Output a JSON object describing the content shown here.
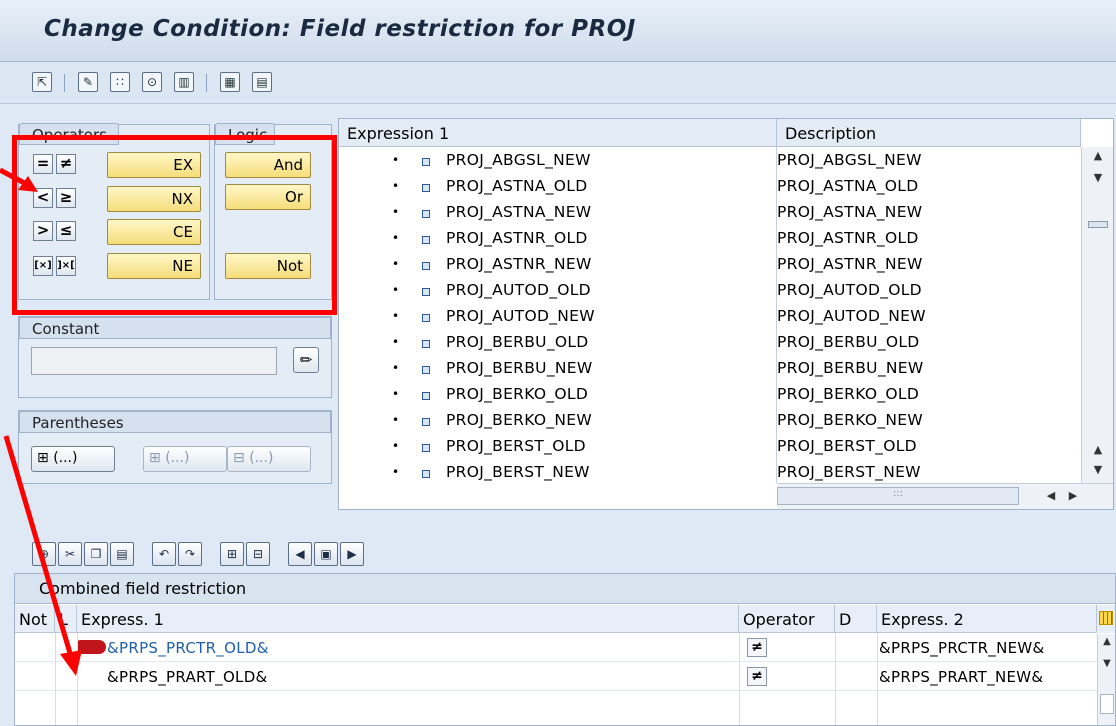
{
  "header": {
    "title": "Change Condition: Field restriction for PROJ"
  },
  "toolbar": {
    "icons": [
      "back-icon",
      "edit-icon",
      "formula-icon",
      "check-icon",
      "table-icon",
      "pattern-icon",
      "grid-icon"
    ]
  },
  "operators": {
    "label": "Operators",
    "symbols": [
      "=",
      "≠",
      "<",
      "≥",
      ">",
      "≤",
      "[×]",
      "]×["
    ],
    "buttons": [
      "EX",
      "NX",
      "CE",
      "NE"
    ]
  },
  "logic": {
    "label": "Logic",
    "buttons": [
      "And",
      "Or",
      "Not"
    ]
  },
  "constant": {
    "label": "Constant",
    "value": ""
  },
  "parentheses": {
    "label": "Parentheses",
    "insert_label": "(...)",
    "wrap_label": "(...)",
    "remove_label": "(...)"
  },
  "expression": {
    "col_expression": "Expression 1",
    "col_description": "Description",
    "rows": [
      {
        "name": "PROJ_ABGSL_NEW",
        "desc": "PROJ_ABGSL_NEW"
      },
      {
        "name": "PROJ_ASTNA_OLD",
        "desc": "PROJ_ASTNA_OLD"
      },
      {
        "name": "PROJ_ASTNA_NEW",
        "desc": "PROJ_ASTNA_NEW"
      },
      {
        "name": "PROJ_ASTNR_OLD",
        "desc": "PROJ_ASTNR_OLD"
      },
      {
        "name": "PROJ_ASTNR_NEW",
        "desc": "PROJ_ASTNR_NEW"
      },
      {
        "name": "PROJ_AUTOD_OLD",
        "desc": "PROJ_AUTOD_OLD"
      },
      {
        "name": "PROJ_AUTOD_NEW",
        "desc": "PROJ_AUTOD_NEW"
      },
      {
        "name": "PROJ_BERBU_OLD",
        "desc": "PROJ_BERBU_OLD"
      },
      {
        "name": "PROJ_BERBU_NEW",
        "desc": "PROJ_BERBU_NEW"
      },
      {
        "name": "PROJ_BERKO_OLD",
        "desc": "PROJ_BERKO_OLD"
      },
      {
        "name": "PROJ_BERKO_NEW",
        "desc": "PROJ_BERKO_NEW"
      },
      {
        "name": "PROJ_BERST_OLD",
        "desc": "PROJ_BERST_OLD"
      },
      {
        "name": "PROJ_BERST_NEW",
        "desc": "PROJ_BERST_NEW"
      }
    ]
  },
  "combined": {
    "title": "Combined field restriction",
    "columns": {
      "not": "Not",
      "l": "L",
      "expr1": "Express. 1",
      "operator": "Operator",
      "d": "D",
      "expr2": "Express. 2"
    },
    "rows": [
      {
        "expr1": "&PRPS_PRCTR_OLD&",
        "operator": "≠",
        "expr2": "&PRPS_PRCTR_NEW&"
      },
      {
        "expr1": "&PRPS_PRART_OLD&",
        "operator": "≠",
        "expr2": "&PRPS_PRART_NEW&"
      }
    ]
  },
  "colors": {
    "highlight_frame": "#ff0000",
    "link_blue": "#1f5fa8",
    "button_yellow": "#f5dd7a"
  }
}
